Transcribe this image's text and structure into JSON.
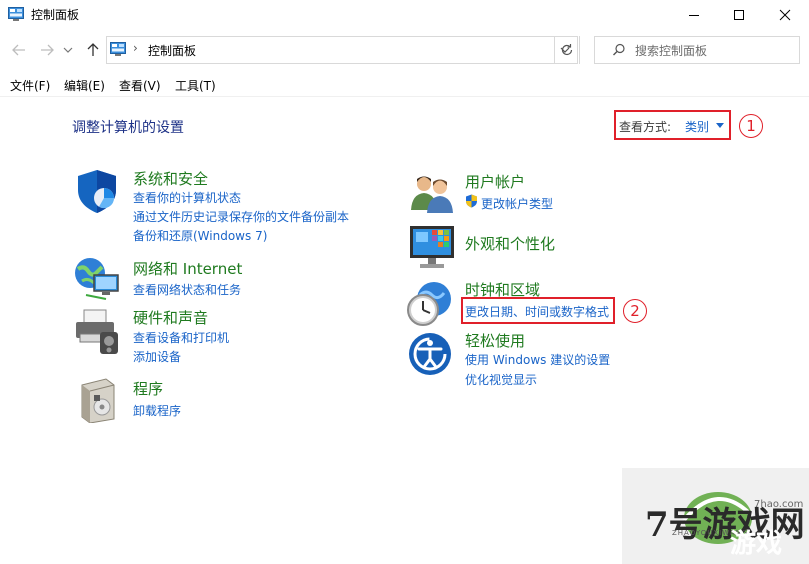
{
  "window": {
    "title": "控制面板",
    "icon": "control-panel-icon",
    "controls": [
      "minimize-icon",
      "maximize-icon",
      "close-icon"
    ]
  },
  "address_bar": {
    "back_icon": "arrow-left-icon",
    "forward_icon": "arrow-right-icon",
    "recent_icon": "chevron-down-icon",
    "up_icon": "arrow-up-icon",
    "breadcrumb_separator": "›",
    "location": "控制面板",
    "refresh_icon": "refresh-icon",
    "search_placeholder": "搜索控制面板"
  },
  "menu": {
    "file": "文件(F)",
    "edit": "编辑(E)",
    "view": "查看(V)",
    "tools": "工具(T)"
  },
  "page": {
    "heading": "调整计算机的设置",
    "view_by_label": "查看方式:",
    "view_by_value": "类别",
    "annotation_1": "1",
    "annotation_2": "2"
  },
  "categories_left": [
    {
      "icon": "shield-icon",
      "title": "系统和安全",
      "links": [
        "查看你的计算机状态",
        "通过文件历史记录保存你的文件备份副本",
        "备份和还原(Windows 7)"
      ]
    },
    {
      "icon": "network-globe-icon",
      "title": "网络和 Internet",
      "links": [
        "查看网络状态和任务"
      ]
    },
    {
      "icon": "printer-icon",
      "title": "硬件和声音",
      "links": [
        "查看设备和打印机",
        "添加设备"
      ]
    },
    {
      "icon": "program-disc-icon",
      "title": "程序",
      "links": [
        "卸载程序"
      ]
    }
  ],
  "categories_right": [
    {
      "icon": "users-icon",
      "title": "用户帐户",
      "links": [
        "更改帐户类型"
      ],
      "link_icon": "uac-shield-icon"
    },
    {
      "icon": "display-icon",
      "title": "外观和个性化",
      "links": []
    },
    {
      "icon": "clock-globe-icon",
      "title": "时钟和区域",
      "links": [
        "更改日期、时间或数字格式"
      ]
    },
    {
      "icon": "ease-of-access-icon",
      "title": "轻松使用",
      "links": [
        "使用 Windows 建议的设置",
        "优化视觉显示"
      ]
    }
  ],
  "watermark": {
    "logo_text": "7号游戏网",
    "logo_pinyin": "ZHAOYOUXIWANG",
    "brand": "游戏",
    "site": "7hao.com"
  },
  "colors": {
    "link": "#1a64c8",
    "category_title": "#1f7a1f",
    "heading": "#1e3287",
    "annotation_red": "#e0202a"
  }
}
